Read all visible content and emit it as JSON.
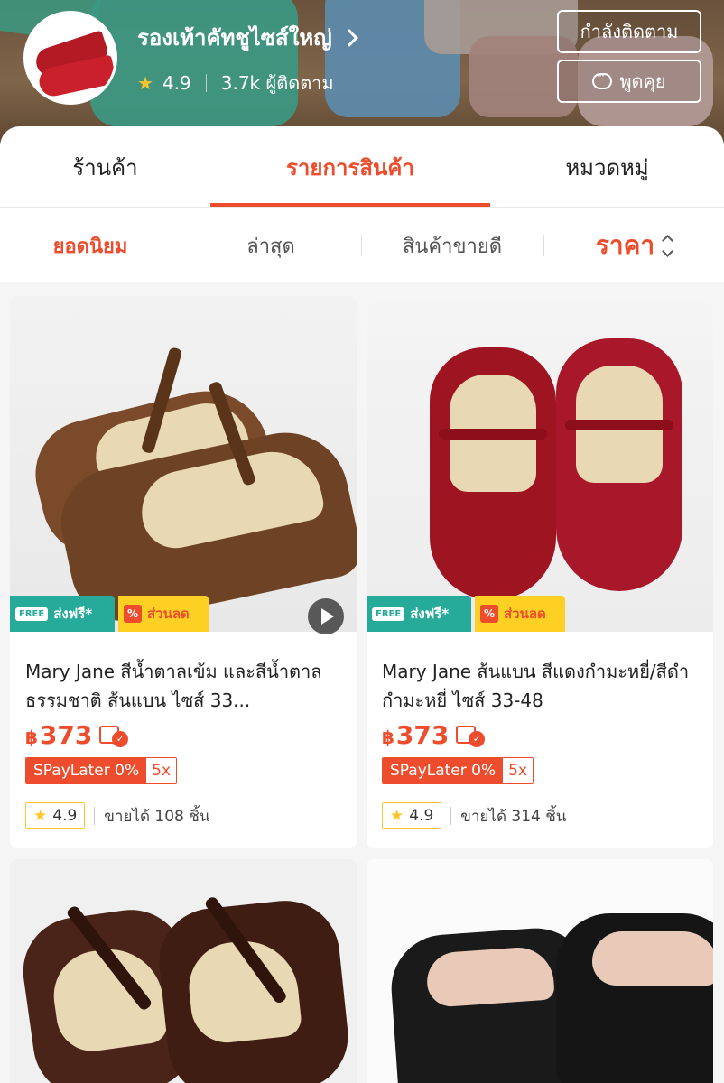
{
  "shop": {
    "name": "รองเท้าคัทชูไซส์ใหญ่",
    "rating": "4.9",
    "followers": "3.7k ผู้ติดตาม",
    "follow_button": "กำลังติดตาม",
    "chat_button": "พูดคุย"
  },
  "tabs": [
    {
      "label": "ร้านค้า",
      "active": false
    },
    {
      "label": "รายการสินค้า",
      "active": true
    },
    {
      "label": "หมวดหมู่",
      "active": false
    }
  ],
  "sort": {
    "popular": "ยอดนิยม",
    "latest": "ล่าสุด",
    "best_selling": "สินค้าขายดี",
    "price": "ราคา"
  },
  "badges": {
    "free_tag": "FREE",
    "free_shipping": "ส่งฟรี*",
    "discount_pct": "%",
    "discount": "ส่วนลด"
  },
  "products": [
    {
      "title": "Mary Jane สีน้ำตาลเข้ม และสีน้ำตาลธรรมชาติ ส้นแบน ไซส์ 33...",
      "currency": "฿",
      "price": "373",
      "paylater": "SPayLater 0%",
      "paylater_x": "5x",
      "rating": "4.9",
      "sold": "ขายได้ 108 ชิ้น",
      "has_video": true
    },
    {
      "title": "Mary Jane ส้นแบน สีแดงกำมะหยี่/สีดำกำมะหยี่ ไซส์ 33-48",
      "currency": "฿",
      "price": "373",
      "paylater": "SPayLater 0%",
      "paylater_x": "5x",
      "rating": "4.9",
      "sold": "ขายได้ 314 ชิ้น",
      "has_video": false
    }
  ],
  "colors": {
    "accent": "#ee4d2d",
    "free_shipping": "#26aa99",
    "discount_badge": "#ffd024",
    "star": "#ffc52b"
  }
}
